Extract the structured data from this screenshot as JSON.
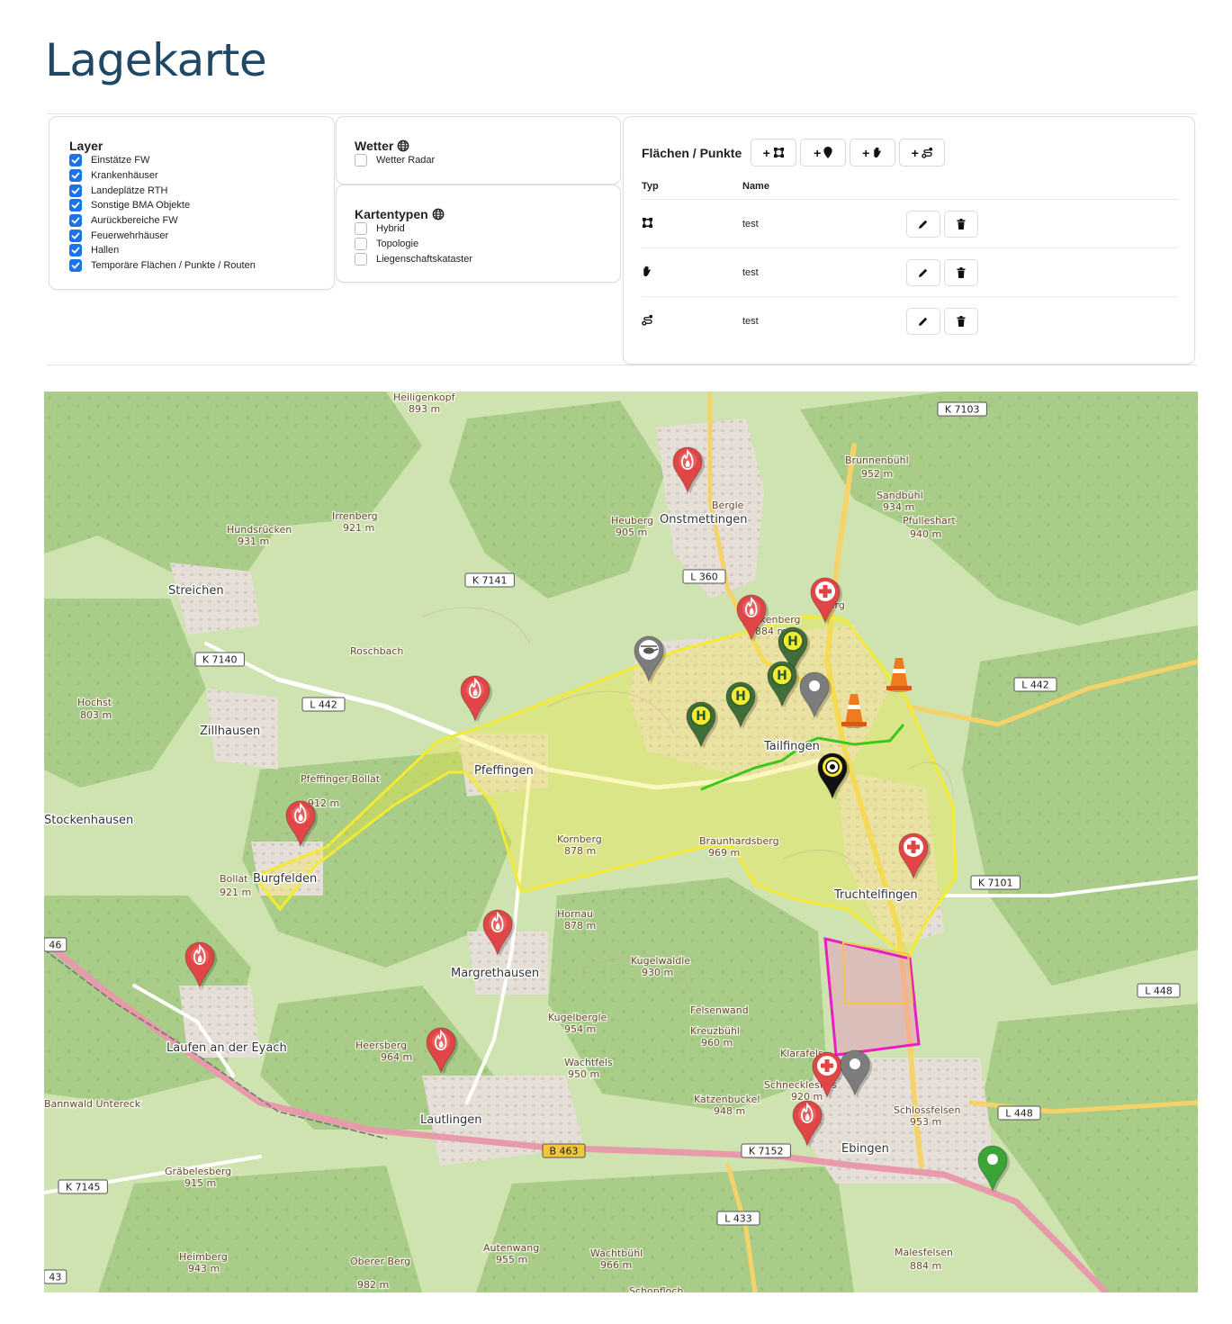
{
  "page": {
    "title": "Lagekarte"
  },
  "layer": {
    "title": "Layer",
    "items": [
      {
        "label": "Einstätze FW",
        "checked": true
      },
      {
        "label": "Krankenhäuser",
        "checked": true
      },
      {
        "label": "Landeplätze RTH",
        "checked": true
      },
      {
        "label": "Sonstige BMA Objekte",
        "checked": true
      },
      {
        "label": "Aurückbereiche FW",
        "checked": true
      },
      {
        "label": "Feuerwehrhäuser",
        "checked": true
      },
      {
        "label": "Hallen",
        "checked": true
      },
      {
        "label": "Temporäre Flächen / Punkte / Routen",
        "checked": true
      }
    ]
  },
  "wetter": {
    "title": "Wetter",
    "items": [
      {
        "label": "Wetter Radar",
        "checked": false
      }
    ]
  },
  "kartentypen": {
    "title": "Kartentypen",
    "items": [
      {
        "label": "Hybrid",
        "checked": false
      },
      {
        "label": "Topologie",
        "checked": false
      },
      {
        "label": "Liegenschaftskataster",
        "checked": false
      }
    ]
  },
  "flaechen": {
    "title": "Flächen / Punkte",
    "add_buttons": [
      {
        "symbol": "+",
        "icon": "polygon-icon"
      },
      {
        "symbol": "+",
        "icon": "marker-icon"
      },
      {
        "symbol": "+",
        "icon": "hand-icon"
      },
      {
        "symbol": "+",
        "icon": "route-icon"
      }
    ],
    "columns": {
      "typ": "Typ",
      "name": "Name"
    },
    "rows": [
      {
        "type_icon": "polygon-icon",
        "name": "test"
      },
      {
        "type_icon": "hand-icon",
        "name": "test"
      },
      {
        "type_icon": "route-icon",
        "name": "test"
      }
    ]
  },
  "map": {
    "colors": {
      "base": "#cfe3b0",
      "forest": "#aecf8c",
      "urban": "#e3dcd5",
      "search_area": "#f4ea33",
      "polygon": "#e81fc3",
      "route": "#3ac91b",
      "fire_marker": "#e04646",
      "hospital_marker": "#e04646",
      "helipad_marker": "#3f6e3b",
      "gray_marker": "#7c7c7c",
      "bma_marker": "#111111",
      "green_marker": "#3aa536",
      "cone": "#f07a1f",
      "major_road": "#e89aaa",
      "secondary_road": "#f6d36a"
    },
    "places": [
      "Heiligenkopf",
      "Onstmettingen",
      "Bergle",
      "Heuberg",
      "Hundsrücken",
      "Irrenberg",
      "Streichen",
      "Zillhausen",
      "Hochst",
      "Pfeffingen",
      "Pfeffinger Bollat",
      "Stockenhausen",
      "Bollat",
      "Burgfelden",
      "Margrethausen",
      "Laufen an der Eyach",
      "Lautlingen",
      "Tailfingen",
      "Truchtelfingen",
      "Ebingen",
      "Brunnenbühl",
      "Sandbühl",
      "Pfulleshart",
      "Markenberg",
      "Burg",
      "Kornberg",
      "Braunhardsberg",
      "Hornau",
      "Kugelwaldle",
      "Kugelbergle",
      "Heersberg",
      "Wachtfels",
      "Felsenwand",
      "Kreuzbühl",
      "Klarafels",
      "Schnecklesfels",
      "Katzenbuckel",
      "Schlossfelsen",
      "Gräbelesberg",
      "Heimberg",
      "Autenwang",
      "Wachtbühl",
      "Oberer Berg",
      "Malesfelsen",
      "Bannwald Untereck",
      "Roschbach",
      "Schopfloch"
    ],
    "roads": [
      "K 7103",
      "K 7141",
      "L 360",
      "K 7140",
      "L 442",
      "L 442",
      "K 7101",
      "L 448",
      "L 448",
      "B 463",
      "K 7152",
      "L 433",
      "K 7145",
      "46",
      "43"
    ],
    "elevations": [
      "893 m",
      "905 m",
      "931 m",
      "921 m",
      "803 m",
      "912 m",
      "921 m",
      "952 m",
      "934 m",
      "940 m",
      "884 m",
      "878 m",
      "969 m",
      "878 m",
      "930 m",
      "954 m",
      "964 m",
      "950 m",
      "960 m",
      "920 m",
      "948 m",
      "953 m",
      "915 m",
      "943 m",
      "955 m",
      "966 m",
      "982 m",
      "884 m"
    ],
    "markers": [
      "fire-marker",
      "fire-marker",
      "fire-marker",
      "fire-marker",
      "fire-marker",
      "fire-marker",
      "fire-marker",
      "fire-marker",
      "hospital-marker",
      "hospital-marker",
      "hospital-marker",
      "helipad-marker",
      "helipad-marker",
      "helipad-marker",
      "helipad-marker",
      "helicopter-marker",
      "gray-marker",
      "gray-marker",
      "bma-marker",
      "green-marker",
      "traffic-cone",
      "traffic-cone"
    ]
  }
}
